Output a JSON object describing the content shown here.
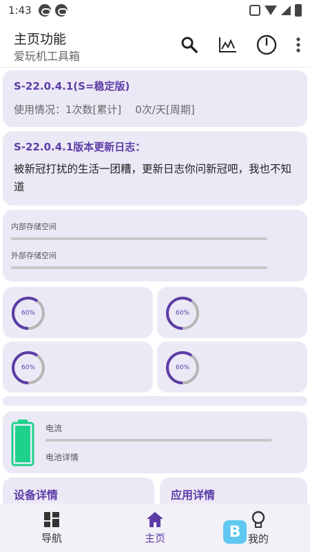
{
  "status": {
    "time": "1:43"
  },
  "app_bar": {
    "title": "主页功能",
    "subtitle": "爱玩机工具箱"
  },
  "version_card": {
    "title": "S-22.0.4.1(S=稳定版)",
    "usage_count": "使用情况：1次数[累计]",
    "usage_rate": "0次/天[周期]"
  },
  "log_card": {
    "title": "S-22.0.4.1版本更新日志：",
    "text": "被新冠打扰的生活一团糟，更新日志你问新冠吧，我也不知道"
  },
  "storage_card": {
    "internal_label": "内部存储空间",
    "external_label": "外部存储空间"
  },
  "rings": [
    {
      "label": "60%",
      "value": 0.6
    },
    {
      "label": "60%",
      "value": 0.6
    },
    {
      "label": "60%",
      "value": 0.6
    },
    {
      "label": "60%",
      "value": 0.6
    }
  ],
  "battery_card": {
    "current_label": "电流",
    "detail_label": "电池详情"
  },
  "details": {
    "device": "设备详情",
    "apps": "应用详情"
  },
  "nav": [
    {
      "label": "导航",
      "icon": "grid-icon"
    },
    {
      "label": "主页",
      "icon": "home-icon"
    },
    {
      "label": "我的",
      "icon": "lightbulb-icon"
    }
  ],
  "colors": {
    "accent": "#5c3da6",
    "card": "#ece9f6",
    "battery": "#1ed18c"
  }
}
